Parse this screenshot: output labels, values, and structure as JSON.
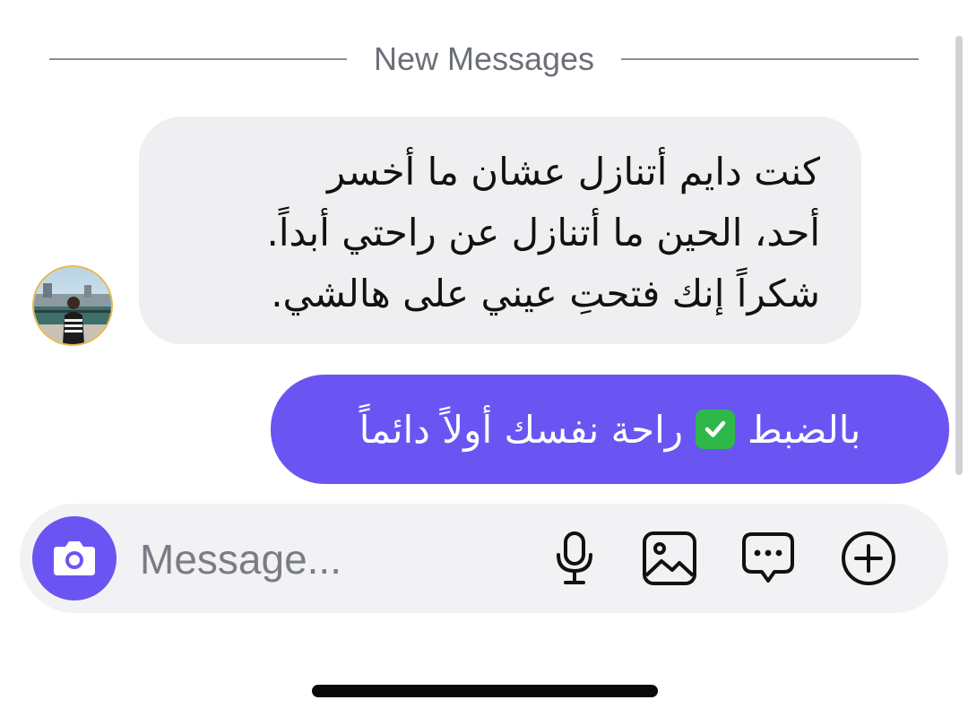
{
  "thread": {
    "divider_label": "New Messages"
  },
  "incoming": {
    "lines": [
      "كنت دايم أتنازل عشان ما أخسر",
      "أحد، الحين ما أتنازل عن راحتي أبداً.",
      "شكراً إنك فتحتِ عيني على هالشي."
    ],
    "avatar_icon": "user-avatar-photo"
  },
  "outgoing": {
    "text_before_emoji": "بالضبط",
    "emoji": "✅",
    "text_after_emoji": "راحة نفسك أولاً دائماً"
  },
  "composer": {
    "placeholder": "Message...",
    "icons": [
      "camera-icon",
      "microphone-icon",
      "image-icon",
      "sticker-chat-icon",
      "add-circle-icon"
    ]
  },
  "colors": {
    "accent": "#6b55f2",
    "incoming_bubble": "#efeff1",
    "composer_bg": "#f2f2f4"
  }
}
